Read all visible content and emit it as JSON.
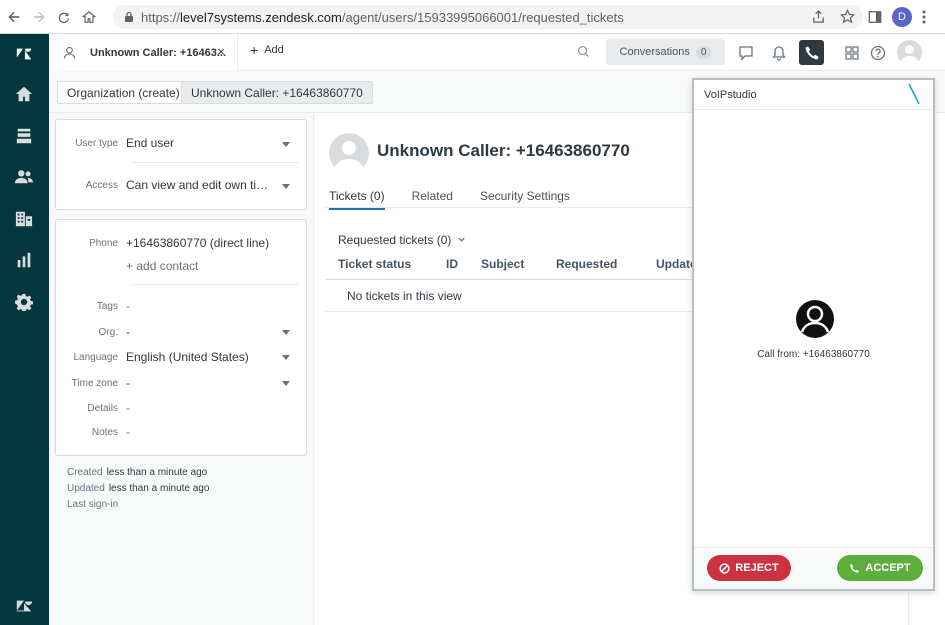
{
  "browser": {
    "url_prefix": "https://",
    "url_host": "level7systems.zendesk.com",
    "url_path": "/agent/users/15933995066001/requested_tickets",
    "profile_initial": "D"
  },
  "topbar": {
    "tab_title": "Unknown Caller: +16463...",
    "tab_close": "×",
    "add_label": "Add",
    "add_plus": "+",
    "conversations_label": "Conversations",
    "conversations_count": "0"
  },
  "breadcrumb": {
    "organization": "Organization (create)",
    "current": "Unknown Caller: +16463860770"
  },
  "user_fields": {
    "user_type_label": "User type",
    "user_type_value": "End user",
    "access_label": "Access",
    "access_value": "Can view and edit own tick...",
    "phone_label": "Phone",
    "phone_value": "+16463860770 (direct line)",
    "add_contact": "+ add contact",
    "tags_label": "Tags",
    "tags_value": "-",
    "org_label": "Org.",
    "org_value": "-",
    "language_label": "Language",
    "language_value": "English (United States)",
    "timezone_label": "Time zone",
    "timezone_value": "-",
    "details_label": "Details",
    "details_value": "-",
    "notes_label": "Notes",
    "notes_value": "-"
  },
  "meta": {
    "created_label": "Created",
    "created_value": "less than a minute ago",
    "updated_label": "Updated",
    "updated_value": "less than a minute ago",
    "last_signin_label": "Last sign-in"
  },
  "main": {
    "user_name": "Unknown Caller: +16463860770",
    "tabs": [
      {
        "label": "Tickets (0)"
      },
      {
        "label": "Related"
      },
      {
        "label": "Security Settings"
      }
    ],
    "requested_title": "Requested tickets (0)",
    "columns": [
      "Ticket status",
      "ID",
      "Subject",
      "Requested",
      "Updated"
    ],
    "empty_text": "No tickets in this view"
  },
  "voip": {
    "title": "VoIPstudio",
    "call_from": "Call from: +16463860770",
    "reject_label": "REJECT",
    "accept_label": "ACCEPT",
    "reject_color": "#cc3340",
    "accept_color": "#5eae3e"
  },
  "icons": {
    "nav": [
      "zendesk-logo-icon",
      "home-icon",
      "views-icon",
      "customers-icon",
      "organizations-icon",
      "reporting-icon",
      "admin-icon",
      "zendesk-z-icon"
    ]
  }
}
